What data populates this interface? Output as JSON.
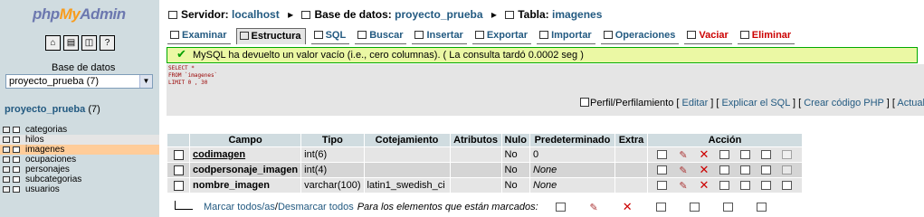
{
  "left": {
    "logo": {
      "php": "php",
      "my": "My",
      "admin": "Admin"
    },
    "db_label": "Base de datos",
    "db_selected": "proyecto_prueba (7)",
    "db_title_name": "proyecto_prueba",
    "db_title_count": "(7)",
    "tables": [
      "categorias",
      "hilos",
      "imagenes",
      "ocupaciones",
      "personajes",
      "subcategorias",
      "usuarios"
    ]
  },
  "breadcrumb": {
    "server_label": "Servidor:",
    "server_value": "localhost",
    "db_label": "Base de datos:",
    "db_value": "proyecto_prueba",
    "table_label": "Tabla:",
    "table_value": "imagenes"
  },
  "tabs": [
    "Examinar",
    "Estructura",
    "SQL",
    "Buscar",
    "Insertar",
    "Exportar",
    "Importar",
    "Operaciones",
    "Vaciar",
    "Eliminar"
  ],
  "message": "MySQL ha devuelto un valor vacío (i.e., cero columnas). ( La consulta tardó 0.0002 seg )",
  "sql": {
    "line1": "SELECT *",
    "line2": "FROM `imagenes`",
    "line3": "LIMIT 0 , 30"
  },
  "sql_links": {
    "profiling": "Perfil/Perfilamiento",
    "edit": "Editar",
    "explain": "Explicar el SQL",
    "php": "Crear código PHP",
    "refresh": "Actuali"
  },
  "structure": {
    "headers": [
      "Campo",
      "Tipo",
      "Cotejamiento",
      "Atributos",
      "Nulo",
      "Predeterminado",
      "Extra",
      "Acción"
    ],
    "rows": [
      {
        "campo": "codimagen",
        "tipo": "int(6)",
        "cotejamiento": "",
        "atributos": "",
        "nulo": "No",
        "predeterminado": "0",
        "extra": ""
      },
      {
        "campo": "codpersonaje_imagen",
        "tipo": "int(4)",
        "cotejamiento": "",
        "atributos": "",
        "nulo": "No",
        "predeterminado": "None",
        "extra": ""
      },
      {
        "campo": "nombre_imagen",
        "tipo": "varchar(100)",
        "cotejamiento": "latin1_swedish_ci",
        "atributos": "",
        "nulo": "No",
        "predeterminado": "None",
        "extra": ""
      }
    ]
  },
  "footer": {
    "check_all": "Marcar todos/as",
    "separator": " / ",
    "uncheck_all": "Desmarcar todos",
    "with_selected": "Para los elementos que están marcados:"
  }
}
